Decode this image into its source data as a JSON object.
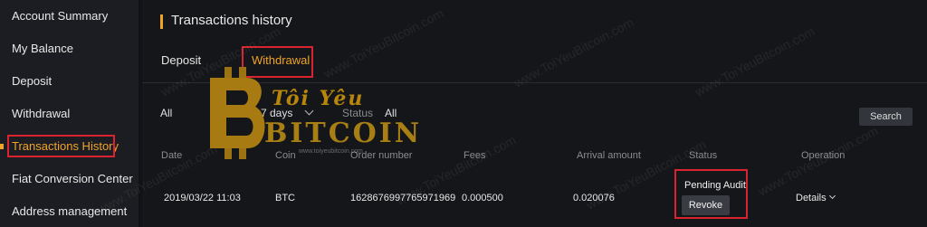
{
  "sidebar": {
    "items": [
      {
        "label": "Account Summary"
      },
      {
        "label": "My Balance"
      },
      {
        "label": "Deposit"
      },
      {
        "label": "Withdrawal"
      },
      {
        "label": "Transactions History",
        "active": true
      },
      {
        "label": "Fiat Conversion Center"
      },
      {
        "label": "Address management"
      }
    ]
  },
  "page": {
    "title": "Transactions history"
  },
  "tabs": [
    {
      "label": "Deposit"
    },
    {
      "label": "Withdrawal",
      "active": true
    }
  ],
  "filters": {
    "coin_value": "All",
    "period_value": "7 days",
    "status_label": "Status",
    "status_value": "All",
    "search_label": "Search"
  },
  "table": {
    "headers": [
      "Date",
      "Coin",
      "Order number",
      "Fees",
      "Arrival amount",
      "Status",
      "Operation"
    ],
    "rows": [
      {
        "date": "2019/03/22 11:03",
        "coin": "BTC",
        "order_number": "1628676997765971969",
        "fees": "0.000500",
        "arrival_amount": "0.020076",
        "status": "Pending Audit",
        "revoke_label": "Revoke",
        "details_label": "Details"
      }
    ]
  },
  "watermark": {
    "tile_text": "www.ToiYeuBitcoin.com",
    "logo_line1": "Tôi Yêu",
    "logo_line2": "BITCOIN",
    "logo_sub": "www.toiyeubitcoin.com"
  },
  "colors": {
    "accent": "#f0a32a",
    "highlight_box": "#d9232e",
    "background": "#15161a",
    "sidebar": "#1c1d22"
  }
}
